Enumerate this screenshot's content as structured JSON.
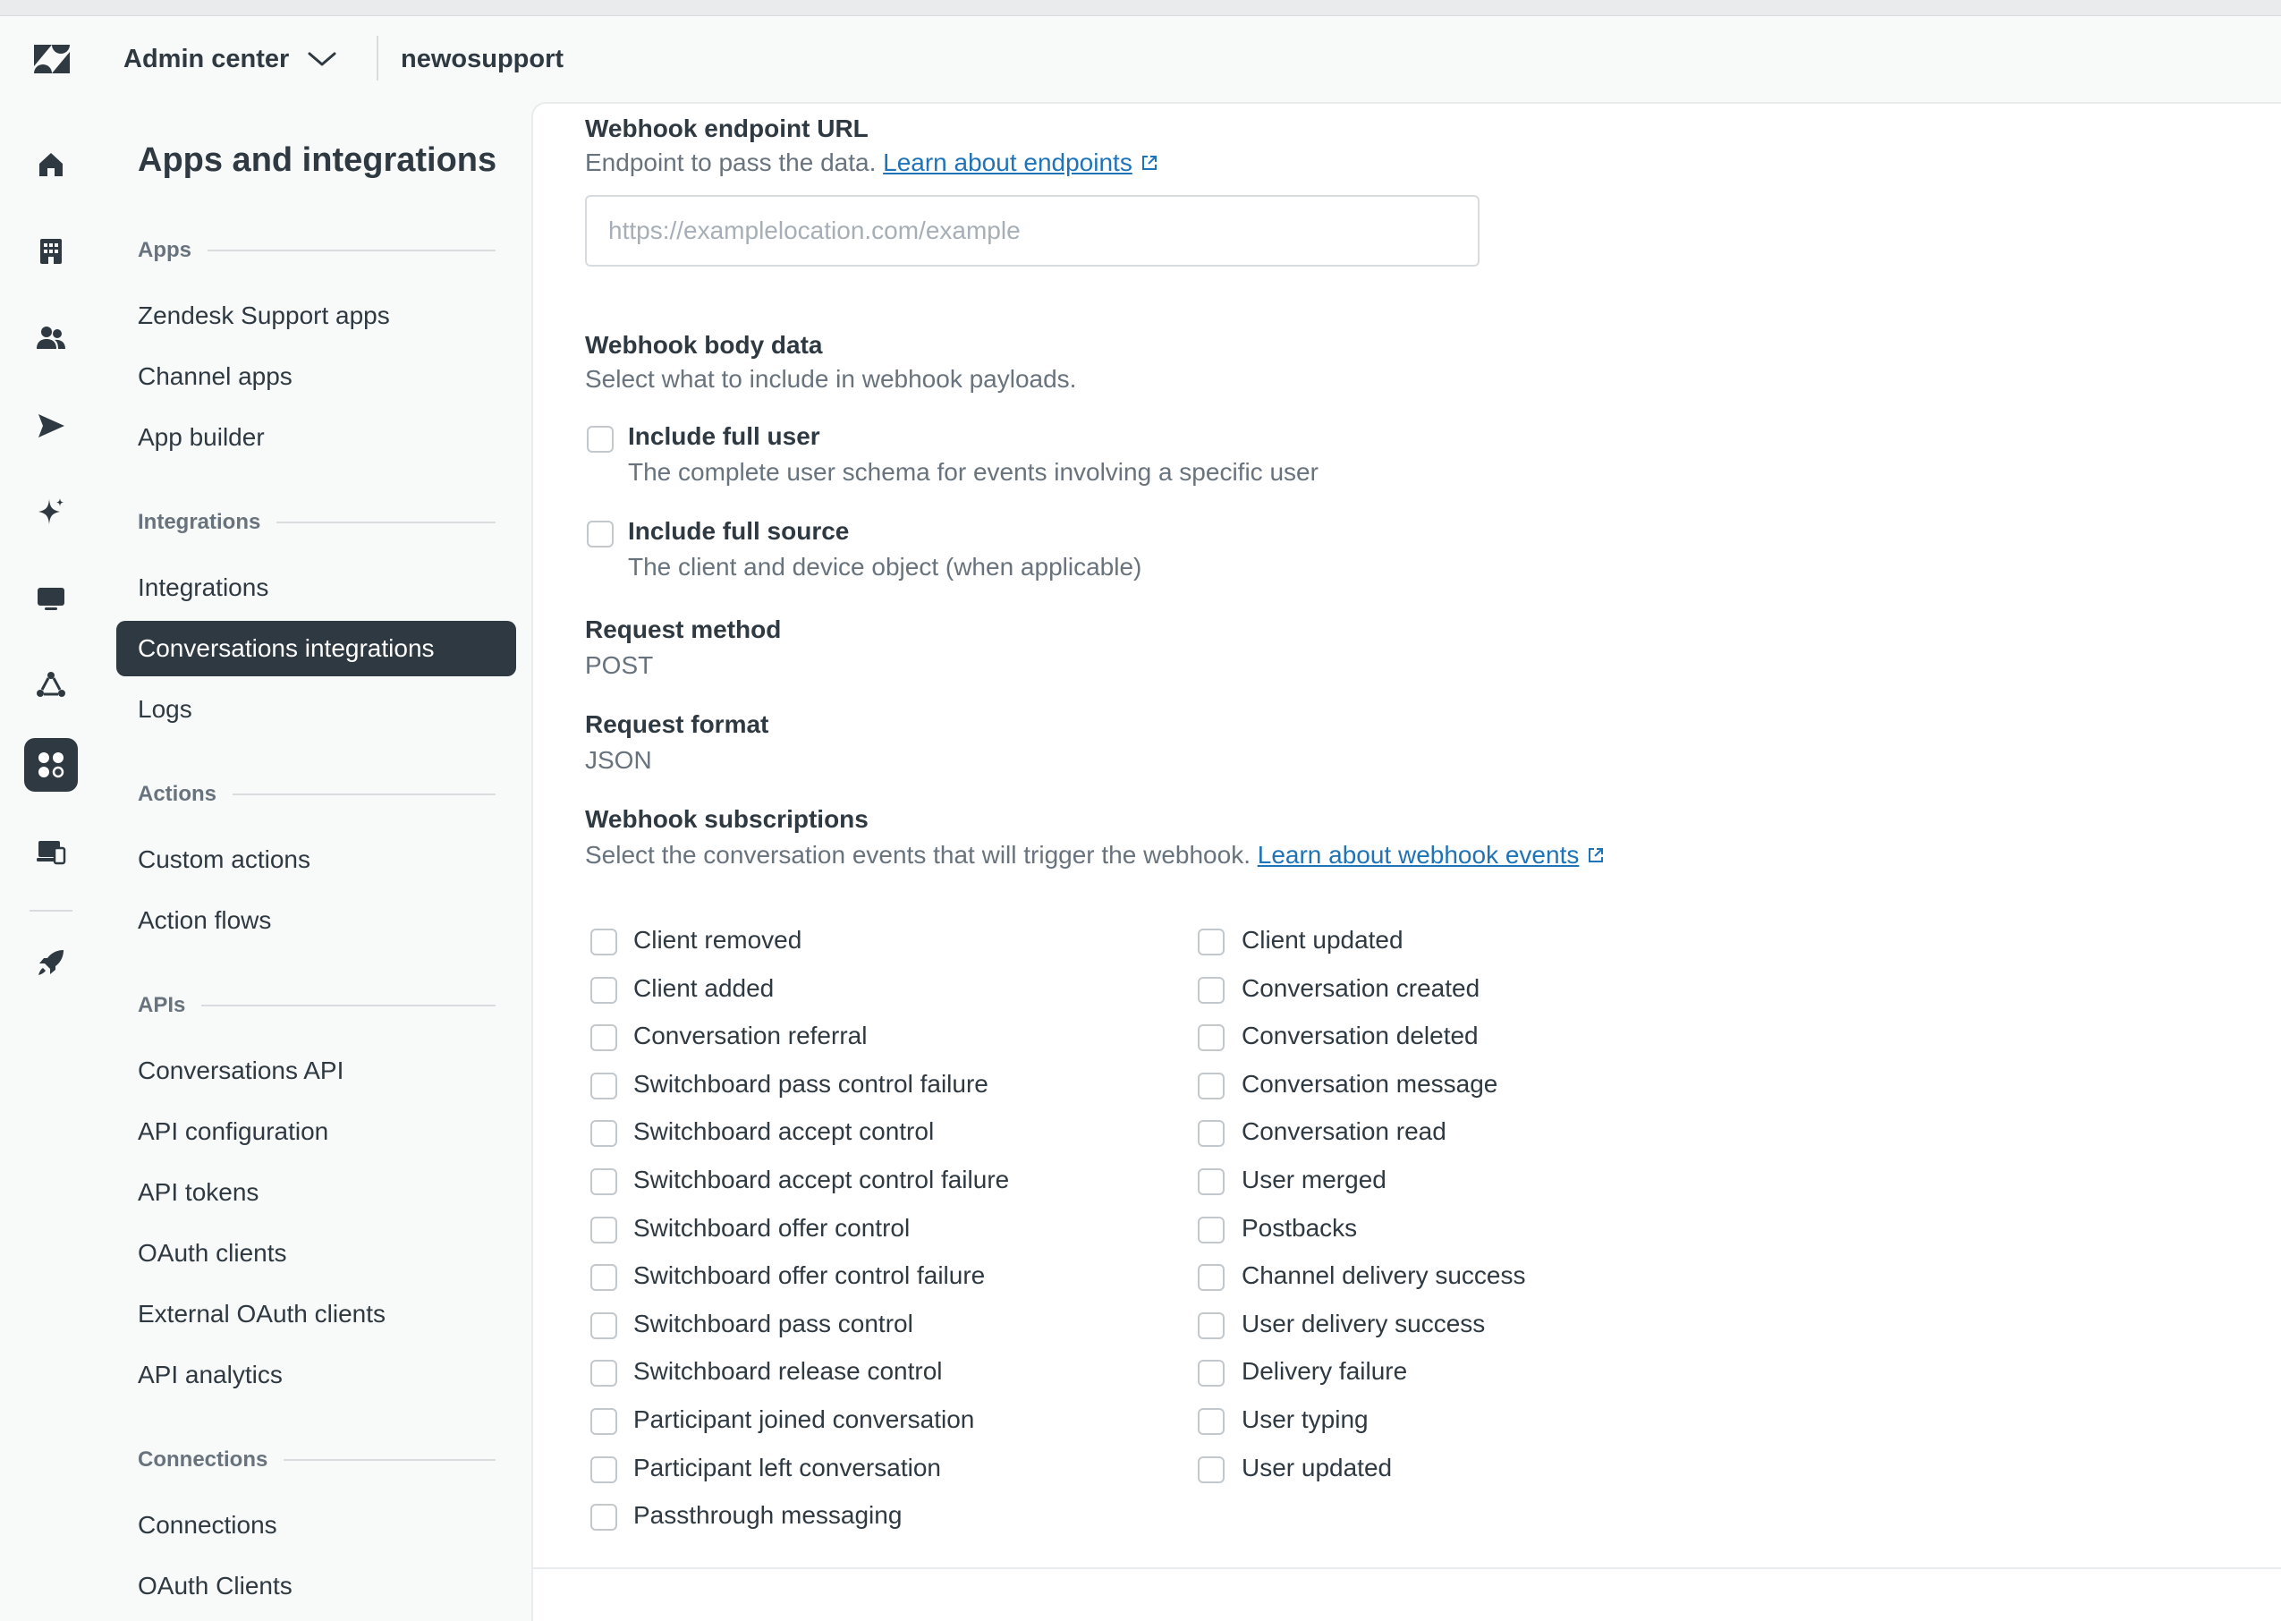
{
  "topbar": {
    "product": "Admin center",
    "account": "newosupport"
  },
  "rail": {
    "items": [
      {
        "icon": "home-icon"
      },
      {
        "icon": "building-icon"
      },
      {
        "icon": "people-icon"
      },
      {
        "icon": "send-icon"
      },
      {
        "icon": "sparkle-icon"
      },
      {
        "icon": "monitor-icon"
      },
      {
        "icon": "workflow-icon"
      },
      {
        "icon": "apps-grid-icon",
        "active": true
      },
      {
        "icon": "devices-icon"
      },
      {
        "icon": "rocket-icon"
      }
    ]
  },
  "sidenav": {
    "title": "Apps and integrations",
    "groups": {
      "apps": "Apps",
      "integrations": "Integrations",
      "actions": "Actions",
      "apis": "APIs",
      "connections": "Connections"
    },
    "items": {
      "support_apps": "Zendesk Support apps",
      "channel_apps": "Channel apps",
      "app_builder": "App builder",
      "integrations": "Integrations",
      "conversations_integrations": "Conversations integrations",
      "logs": "Logs",
      "custom_actions": "Custom actions",
      "action_flows": "Action flows",
      "conversations_api": "Conversations API",
      "api_configuration": "API configuration",
      "api_tokens": "API tokens",
      "oauth_clients": "OAuth clients",
      "external_oauth_clients": "External OAuth clients",
      "api_analytics": "API analytics",
      "connections": "Connections",
      "oauth_clients_2": "OAuth Clients"
    }
  },
  "form": {
    "endpoint": {
      "label": "Webhook endpoint URL",
      "hint": "Endpoint to pass the data.",
      "link": "Learn about endpoints",
      "placeholder": "https://examplelocation.com/example",
      "value": ""
    },
    "body_data": {
      "label": "Webhook body data",
      "hint": "Select what to include in webhook payloads.",
      "full_user_title": "Include full user",
      "full_user_desc": "The complete user schema for events involving a specific user",
      "full_source_title": "Include full source",
      "full_source_desc": "The client and device object (when applicable)"
    },
    "request_method": {
      "label": "Request method",
      "value": "POST"
    },
    "request_format": {
      "label": "Request format",
      "value": "JSON"
    },
    "subscriptions": {
      "label": "Webhook subscriptions",
      "hint": "Select the conversation events that will trigger the webhook.",
      "link": "Learn about webhook events",
      "left": [
        "Client removed",
        "Client added",
        "Conversation referral",
        "Switchboard pass control failure",
        "Switchboard accept control",
        "Switchboard accept control failure",
        "Switchboard offer control",
        "Switchboard offer control failure",
        "Switchboard pass control",
        "Switchboard release control",
        "Participant joined conversation",
        "Participant left conversation",
        "Passthrough messaging"
      ],
      "right": [
        "Client updated",
        "Conversation created",
        "Conversation deleted",
        "Conversation message",
        "Conversation read",
        "User merged",
        "Postbacks",
        "Channel delivery success",
        "User delivery success",
        "Delivery failure",
        "User typing",
        "User updated"
      ]
    }
  }
}
